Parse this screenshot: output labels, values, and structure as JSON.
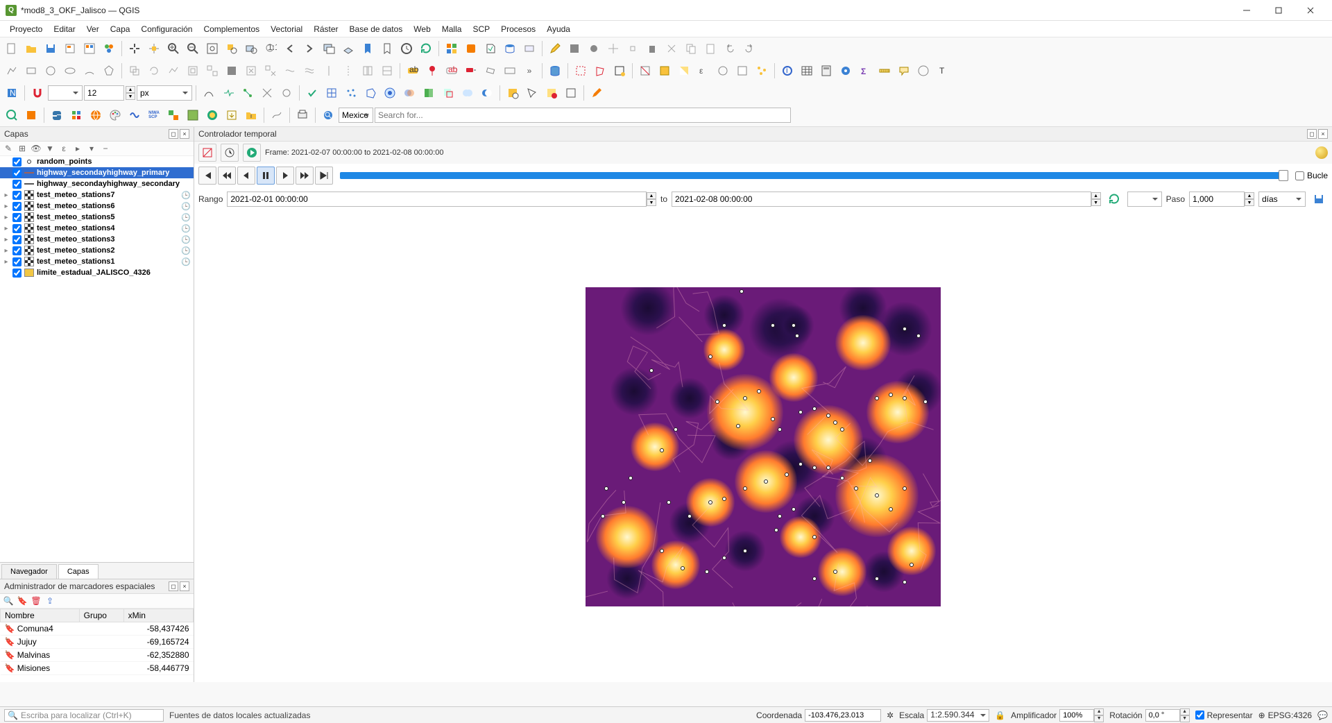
{
  "window": {
    "title": "*mod8_3_OKF_Jalisco — QGIS"
  },
  "menu": [
    "Proyecto",
    "Editar",
    "Ver",
    "Capa",
    "Configuración",
    "Complementos",
    "Vectorial",
    "Ráster",
    "Base de datos",
    "Web",
    "Malla",
    "SCP",
    "Procesos",
    "Ayuda"
  ],
  "snap": {
    "value": "12",
    "unit": "px"
  },
  "geocoder": {
    "country": "Mexico",
    "placeholder": "Search for..."
  },
  "layers_panel": {
    "title": "Capas",
    "items": [
      {
        "name": "random_points",
        "sym": "point",
        "checked": true,
        "expand": "",
        "clock": false,
        "selected": false
      },
      {
        "name": "highway_secondayhighway_primary",
        "sym": "line-brown",
        "checked": true,
        "expand": "",
        "clock": false,
        "selected": true
      },
      {
        "name": "highway_secondayhighway_secondary",
        "sym": "line-gray",
        "checked": true,
        "expand": "",
        "clock": false,
        "selected": false
      },
      {
        "name": "test_meteo_stations7",
        "sym": "checker",
        "checked": true,
        "expand": "▸",
        "clock": true,
        "selected": false
      },
      {
        "name": "test_meteo_stations6",
        "sym": "checker",
        "checked": true,
        "expand": "▸",
        "clock": true,
        "selected": false
      },
      {
        "name": "test_meteo_stations5",
        "sym": "checker",
        "checked": true,
        "expand": "▸",
        "clock": true,
        "selected": false
      },
      {
        "name": "test_meteo_stations4",
        "sym": "checker",
        "checked": true,
        "expand": "▸",
        "clock": true,
        "selected": false
      },
      {
        "name": "test_meteo_stations3",
        "sym": "checker",
        "checked": true,
        "expand": "▸",
        "clock": true,
        "selected": false
      },
      {
        "name": "test_meteo_stations2",
        "sym": "checker",
        "checked": true,
        "expand": "▸",
        "clock": true,
        "selected": false
      },
      {
        "name": "test_meteo_stations1",
        "sym": "checker",
        "checked": true,
        "expand": "▸",
        "clock": true,
        "selected": false
      },
      {
        "name": "limite_estadual_JALISCO_4326",
        "sym": "poly",
        "checked": true,
        "expand": "",
        "clock": false,
        "selected": false
      }
    ],
    "tabs": {
      "browser": "Navegador",
      "layers": "Capas"
    }
  },
  "bookmarks": {
    "title": "Administrador de marcadores espaciales",
    "cols": [
      "Nombre",
      "Grupo",
      "xMin"
    ],
    "rows": [
      {
        "name": "Comuna4",
        "group": "",
        "xmin": "-58,437426"
      },
      {
        "name": "Jujuy",
        "group": "",
        "xmin": "-69,165724"
      },
      {
        "name": "Malvinas",
        "group": "",
        "xmin": "-62,352880"
      },
      {
        "name": "Misiones",
        "group": "",
        "xmin": "-58,446779"
      }
    ]
  },
  "temporal": {
    "title": "Controlador temporal",
    "frame_label": "Frame: 2021-02-07 00:00:00 to 2021-02-08 00:00:00",
    "range_label": "Rango",
    "to_label": "to",
    "start": "2021-02-01 00:00:00",
    "end": "2021-02-08 00:00:00",
    "step_label": "Paso",
    "step_value": "1,000",
    "step_unit": "días",
    "bucle_label": "Bucle"
  },
  "status": {
    "placeholder": "Escriba para localizar (Ctrl+K)",
    "message": "Fuentes de datos locales actualizadas",
    "coord_label": "Coordenada",
    "coord_value": "-103.476,23.013",
    "scale_label": "Escala",
    "scale_value": "1:2.590.344",
    "mag_label": "Amplificador",
    "mag_value": "100%",
    "rot_label": "Rotación",
    "rot_value": "0,0 °",
    "render_label": "Representar",
    "crs": "EPSG:4326"
  }
}
